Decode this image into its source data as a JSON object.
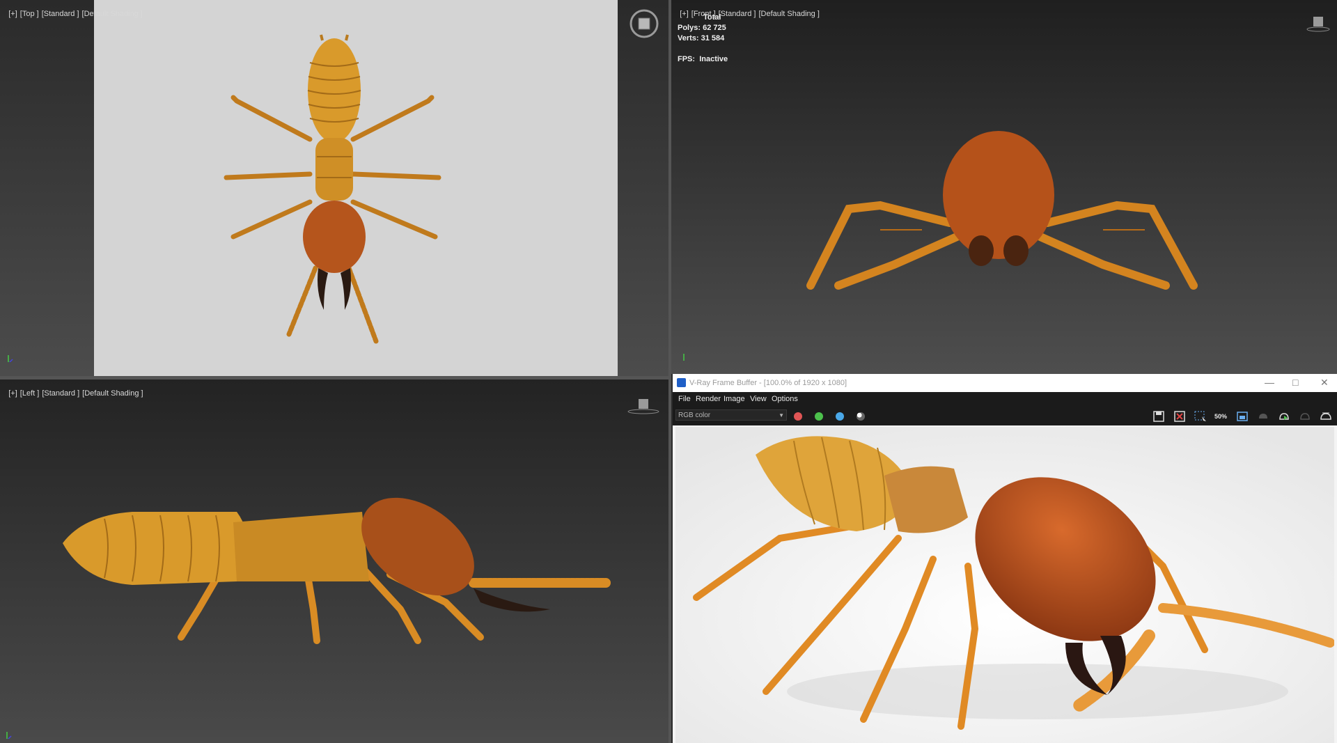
{
  "viewports": {
    "top": {
      "label_parts": [
        "[+]",
        "[Top ]",
        "[Standard ]",
        "[Default Shading ]"
      ]
    },
    "front": {
      "label_parts": [
        "[+]",
        "[Front ]",
        "[Standard ]",
        "[Default Shading ]"
      ],
      "stats": {
        "header": "Total",
        "polys_label": "Polys:",
        "polys_value": "62 725",
        "verts_label": "Verts:",
        "verts_value": "31 584",
        "fps_label": "FPS:",
        "fps_value": "Inactive"
      }
    },
    "left": {
      "label_parts": [
        "[+]",
        "[Left ]",
        "[Standard ]",
        "[Default Shading ]"
      ]
    }
  },
  "vfb": {
    "title": "V-Ray Frame Buffer - [100.0% of 1920 x 1080]",
    "menu": [
      "File",
      "Render",
      "Image",
      "View",
      "Options"
    ],
    "channel": "RGB color",
    "zoom_badge": "50%",
    "colors": {
      "red": "#e05555",
      "green": "#4cc04c",
      "blue": "#4aa8e8"
    }
  },
  "colors": {
    "termite_body": "#d99a2b",
    "termite_head": "#b5551c",
    "mandible": "#2a1a12",
    "viewport_bg_top": "#2a2a2a",
    "viewport_bg_bottom": "#555555"
  }
}
